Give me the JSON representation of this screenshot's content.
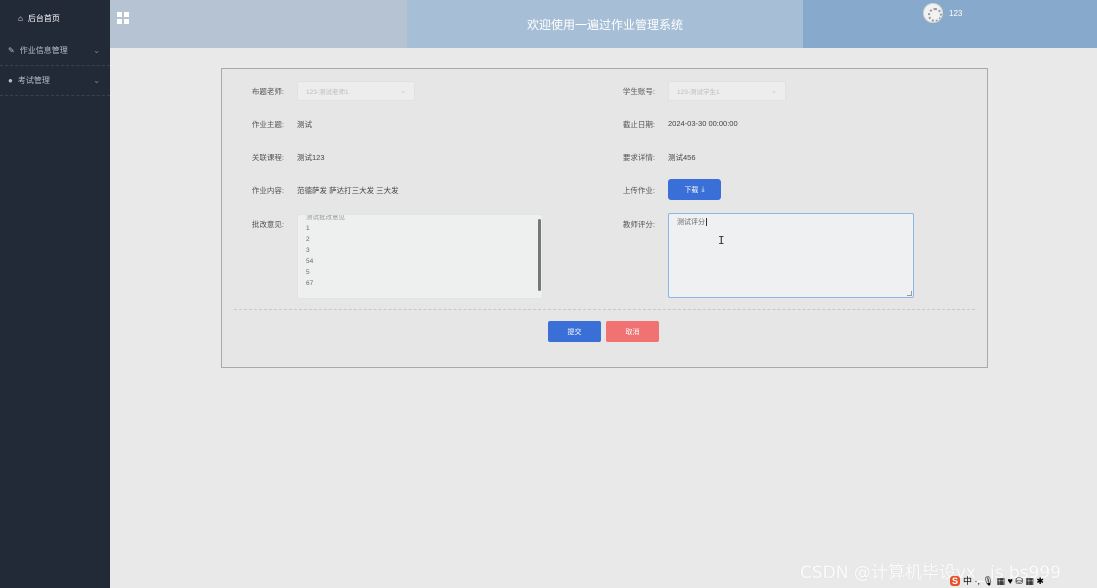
{
  "sidebar": {
    "home": "后台首页",
    "items": [
      {
        "label": "作业信息管理"
      },
      {
        "label": "考试管理"
      }
    ]
  },
  "header": {
    "title": "欢迎使用一遍过作业管理系统",
    "username": "123"
  },
  "form": {
    "teacher_label": "布题老师:",
    "teacher_value": "123-测试老师1",
    "student_label": "学生账号:",
    "student_value": "123-测试学生1",
    "topic_label": "作业主题:",
    "topic_value": "测试",
    "deadline_label": "截止日期:",
    "deadline_value": "2024-03-30 00:00:00",
    "course_label": "关联课程:",
    "course_value": "测试123",
    "req_label": "要求详情:",
    "req_value": "测试456",
    "content_label": "作业内容:",
    "content_value": "范德萨发 萨达打三大发 三大发",
    "upload_label": "上传作业:",
    "download_btn": "下载",
    "comment_label": "批改意见:",
    "comment_lines": [
      "测试批改意见",
      "1",
      "2",
      "3",
      "54",
      "5",
      "67"
    ],
    "score_label": "教师评分:",
    "score_value": "测试评分"
  },
  "buttons": {
    "submit": "提交",
    "cancel": "取消"
  },
  "overlay": {
    "watermark": "CSDN @计算机毕设vx_ js bs999",
    "tray_logo": "S",
    "tray_text": "中 ·, 🎙 ▦ ♥ ⛁ ▦ ✱"
  },
  "colors": {
    "sidebar_bg": "#232a37",
    "primary": "#3b6fd8",
    "danger": "#f07272"
  }
}
